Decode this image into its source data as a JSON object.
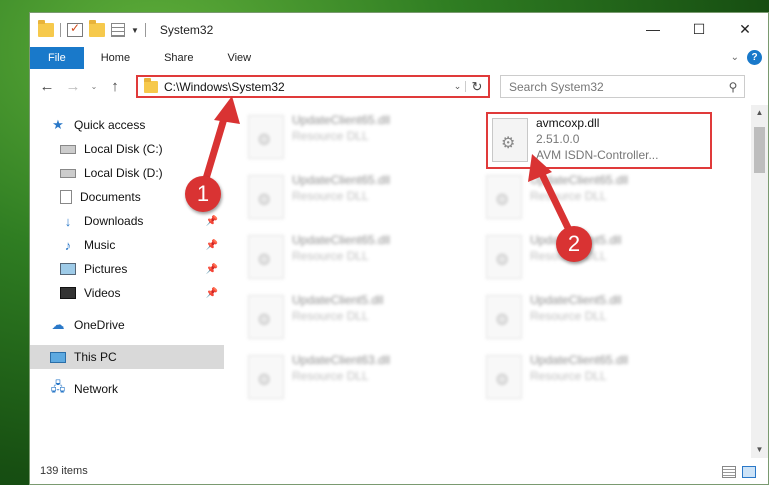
{
  "window": {
    "title": "System32"
  },
  "ribbon": {
    "tabs": [
      "File",
      "Home",
      "Share",
      "View"
    ]
  },
  "address": {
    "path": "C:\\Windows\\System32"
  },
  "search": {
    "placeholder": "Search System32"
  },
  "sidebar": {
    "quick_access": "Quick access",
    "items": [
      {
        "label": "Local Disk (C:)",
        "pinned": false
      },
      {
        "label": "Local Disk (D:)",
        "pinned": false
      },
      {
        "label": "Documents",
        "pinned": true
      },
      {
        "label": "Downloads",
        "pinned": true
      },
      {
        "label": "Music",
        "pinned": true
      },
      {
        "label": "Pictures",
        "pinned": true
      },
      {
        "label": "Videos",
        "pinned": true
      }
    ],
    "onedrive": "OneDrive",
    "this_pc": "This PC",
    "network": "Network"
  },
  "files": {
    "left": [
      {
        "name": "UpdateClient65.dll",
        "desc": "Resource DLL"
      },
      {
        "name": "UpdateClient65.dll",
        "desc": "Resource DLL"
      },
      {
        "name": "UpdateClient65.dll",
        "desc": "Resource DLL"
      },
      {
        "name": "UpdateClient5.dll",
        "desc": "Resource DLL"
      },
      {
        "name": "UpdateClient63.dll",
        "desc": "Resource DLL"
      }
    ],
    "right": [
      {
        "name": "UpdateClient65.dll",
        "desc": "Resource DLL"
      },
      {
        "name": "UpdateClient5.dll",
        "desc": "Resource DLL"
      },
      {
        "name": "UpdateClient5.dll",
        "desc": "Resource DLL"
      },
      {
        "name": "UpdateClient65.dll",
        "desc": "Resource DLL"
      }
    ],
    "target": {
      "name": "avmcoxp.dll",
      "version": "2.51.0.0",
      "desc": "AVM ISDN-Controller..."
    }
  },
  "status": {
    "count": "139 items"
  },
  "callouts": [
    "1",
    "2"
  ],
  "colors": {
    "highlight": "#e03a3a",
    "accent": "#1979ca"
  }
}
